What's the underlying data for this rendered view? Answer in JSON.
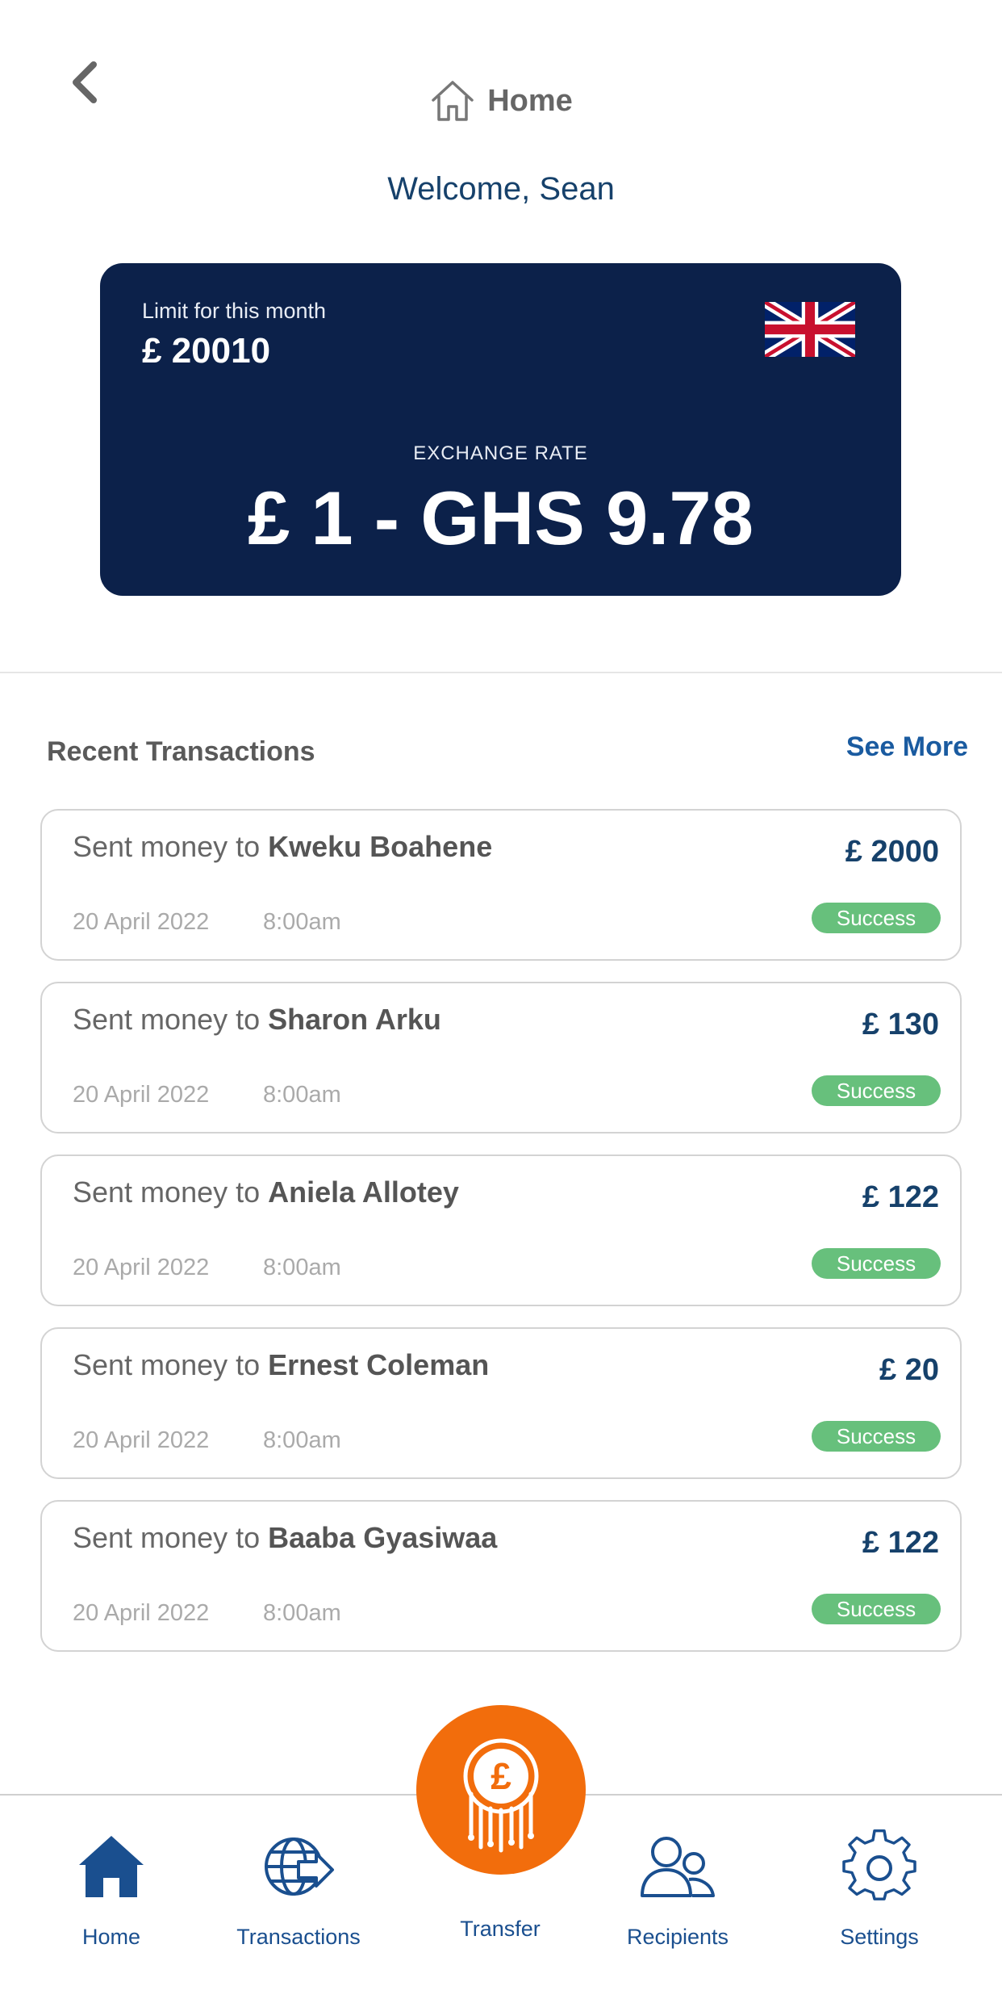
{
  "header": {
    "title": "Home",
    "back_icon": "chevron-left-icon",
    "home_icon": "house-outline-icon"
  },
  "welcome": "Welcome, Sean",
  "card": {
    "limit_label": "Limit for this month",
    "limit_value": "£ 20010",
    "flag": "uk-flag-icon",
    "rate_label": "EXCHANGE RATE",
    "rate_value": "£ 1 - GHS 9.78",
    "background": "#0c214a"
  },
  "recent": {
    "title": "Recent Transactions",
    "see_more": "See More",
    "items": [
      {
        "prefix": "Sent money to ",
        "name": "Kweku Boahene",
        "amount": "£ 2000",
        "date": "20 April 2022",
        "time": "8:00am",
        "status": "Success"
      },
      {
        "prefix": "Sent money to ",
        "name": "Sharon Arku",
        "amount": "£ 130",
        "date": "20 April 2022",
        "time": "8:00am",
        "status": "Success"
      },
      {
        "prefix": "Sent money to ",
        "name": "Aniela Allotey",
        "amount": "£ 122",
        "date": "20 April 2022",
        "time": "8:00am",
        "status": "Success"
      },
      {
        "prefix": "Sent money to ",
        "name": "Ernest Coleman",
        "amount": "£ 20",
        "date": "20 April 2022",
        "time": "8:00am",
        "status": "Success"
      },
      {
        "prefix": "Sent money to ",
        "name": "Baaba Gyasiwaa",
        "amount": "£ 122",
        "date": "20 April 2022",
        "time": "8:00am",
        "status": "Success"
      }
    ]
  },
  "nav": {
    "home": "Home",
    "transactions": "Transactions",
    "transfer": "Transfer",
    "recipients": "Recipients",
    "settings": "Settings"
  },
  "colors": {
    "accent": "#16416b",
    "success": "#67c07c",
    "transfer": "#f26d0c",
    "link": "#1a5ba0"
  }
}
